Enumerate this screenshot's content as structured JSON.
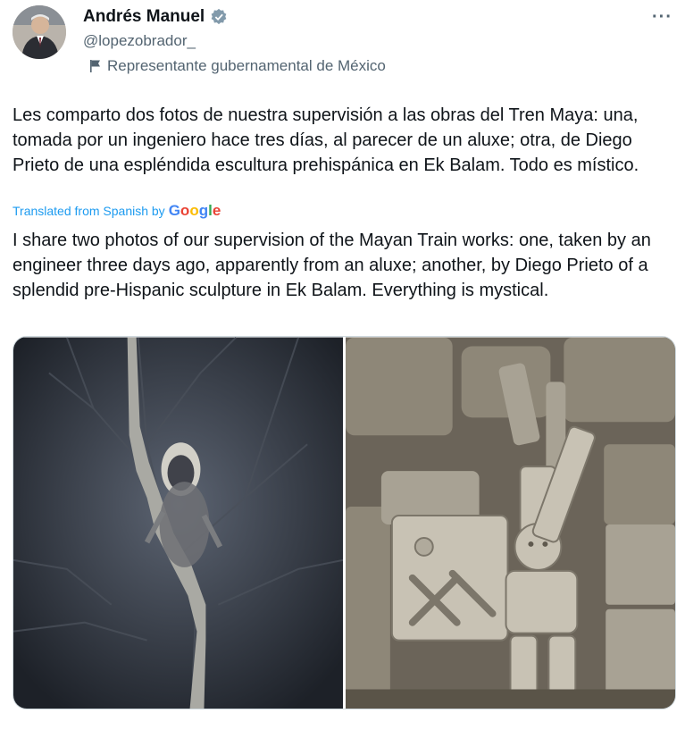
{
  "author": {
    "name": "Andrés Manuel",
    "handle": "@lopezobrador_",
    "verified_icon": "verified-badge-icon",
    "affiliation": "Representante gubernamental de México"
  },
  "more_label": "···",
  "tweet": {
    "original_text": "Les comparto dos fotos de nuestra supervisión a las obras del Tren Maya: una, tomada por un ingeniero hace tres días, al parecer de un aluxe; otra, de Diego Prieto de una espléndida escultura prehispánica en Ek Balam. Todo es místico.",
    "translated_label": "Translated from Spanish by",
    "translated_provider": [
      "G",
      "o",
      "o",
      "g",
      "l",
      "e"
    ],
    "translated_text": "I share two photos of our supervision of the Mayan Train works: one, taken by an engineer three days ago, apparently from an aluxe; another, by Diego Prieto of a splendid pre-Hispanic sculpture in Ek Balam. Everything is mystical."
  },
  "colors": {
    "link": "#1d9bf0",
    "muted": "#536471",
    "text": "#0f1419"
  }
}
